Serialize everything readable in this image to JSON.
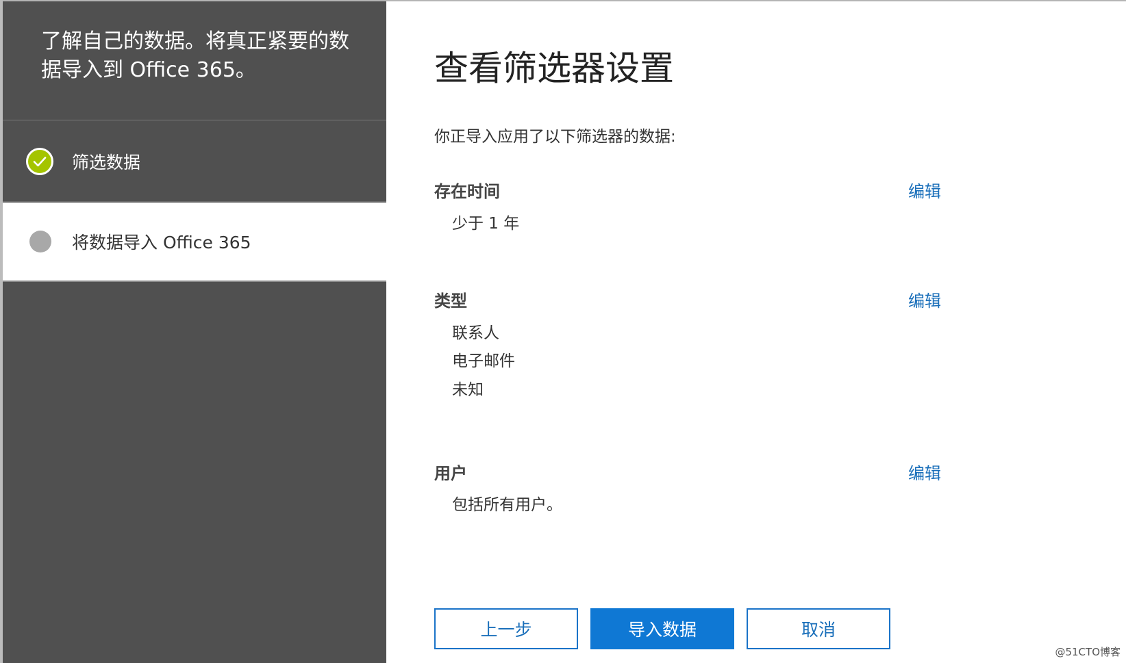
{
  "sidebar": {
    "header_text": "了解自己的数据。将真正紧要的数据导入到 Office 365。",
    "steps": [
      {
        "label": "筛选数据",
        "status": "completed",
        "icon": "check-circle-icon"
      },
      {
        "label": "将数据导入 Office 365",
        "status": "current",
        "icon": "circle-icon"
      }
    ]
  },
  "main": {
    "title": "查看筛选器设置",
    "intro": "你正导入应用了以下筛选器的数据:",
    "sections": [
      {
        "title": "存在时间",
        "edit_label": "编辑",
        "values": [
          "少于 1 年"
        ]
      },
      {
        "title": "类型",
        "edit_label": "编辑",
        "values": [
          "联系人",
          "电子邮件",
          "未知"
        ]
      },
      {
        "title": "用户",
        "edit_label": "编辑",
        "values": [
          "包括所有用户。"
        ]
      }
    ]
  },
  "footer": {
    "back_label": "上一步",
    "import_label": "导入数据",
    "cancel_label": "取消"
  },
  "watermark": "@51CTO博客",
  "colors": {
    "sidebar_bg": "#505050",
    "accent_green": "#a4c400",
    "link_blue": "#1a6fba",
    "primary_blue": "#0f78d4"
  }
}
